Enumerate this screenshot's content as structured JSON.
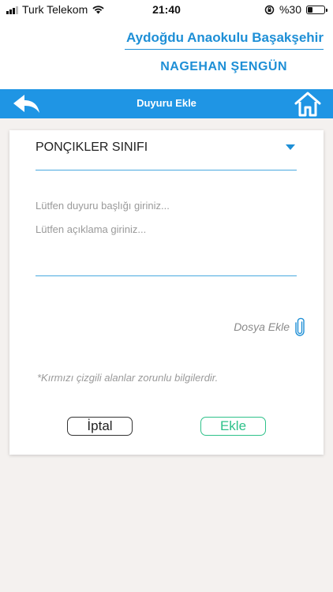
{
  "status_bar": {
    "carrier": "Turk Telekom",
    "time": "21:40",
    "battery_percent": "%30",
    "battery_level": 0.3
  },
  "header": {
    "school_name": "Aydoğdu Anaokulu Başakşehir",
    "teacher_name": "NAGEHAN  ŞENGÜN"
  },
  "nav": {
    "title": "Duyuru Ekle",
    "back_icon": "back-arrow-icon",
    "home_icon": "home-icon",
    "color": "#1f95e4"
  },
  "form": {
    "class_selected": "PONÇIKLER SINIFI",
    "title_placeholder": "Lütfen duyuru başlığı giriniz...",
    "description_placeholder": "Lütfen açıklama giriniz...",
    "attach_label": "Dosya Ekle",
    "attach_icon": "paperclip-icon",
    "required_note": "*Kırmızı çizgili alanlar zorunlu bilgilerdir.",
    "cancel_label": "İptal",
    "add_label": "Ekle",
    "accent_color": "#1e8fd6",
    "add_color": "#2ec18a"
  }
}
